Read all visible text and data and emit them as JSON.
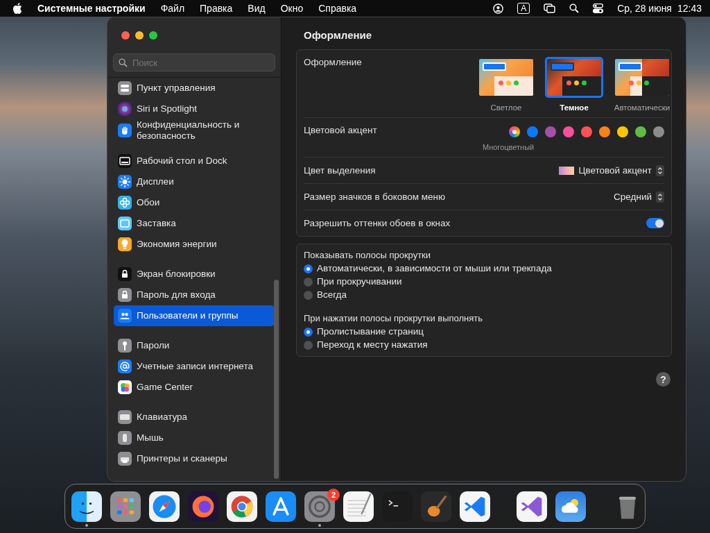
{
  "menubar": {
    "app_name": "Системные настройки",
    "menus": [
      "Файл",
      "Правка",
      "Вид",
      "Окно",
      "Справка"
    ],
    "input_source": "A",
    "date": "Ср, 28 июня",
    "time": "12:43"
  },
  "sidebar": {
    "search": {
      "placeholder": "Поиск"
    },
    "groups": [
      {
        "items": [
          {
            "label": "Пункт управления",
            "selected": false
          },
          {
            "label": "Siri и Spotlight",
            "selected": false
          },
          {
            "label": "Конфиденциальность и безопасность",
            "selected": false
          }
        ]
      },
      {
        "items": [
          {
            "label": "Рабочий стол и Dock",
            "selected": false
          },
          {
            "label": "Дисплеи",
            "selected": false
          },
          {
            "label": "Обои",
            "selected": false
          },
          {
            "label": "Заставка",
            "selected": false
          },
          {
            "label": "Экономия энергии",
            "selected": false
          }
        ]
      },
      {
        "items": [
          {
            "label": "Экран блокировки",
            "selected": false
          },
          {
            "label": "Пароль для входа",
            "selected": false
          },
          {
            "label": "Пользователи и группы",
            "selected": true
          }
        ]
      },
      {
        "items": [
          {
            "label": "Пароли",
            "selected": false
          },
          {
            "label": "Учетные записи интернета",
            "selected": false
          },
          {
            "label": "Game Center",
            "selected": false
          }
        ]
      },
      {
        "items": [
          {
            "label": "Клавиатура",
            "selected": false
          },
          {
            "label": "Мышь",
            "selected": false
          },
          {
            "label": "Принтеры и сканеры",
            "selected": false
          }
        ]
      }
    ]
  },
  "content": {
    "title": "Оформление",
    "appearance": {
      "label": "Оформление",
      "options": [
        {
          "kind": "light",
          "label": "Светлое",
          "selected": false
        },
        {
          "kind": "dark",
          "label": "Темное",
          "selected": true
        },
        {
          "kind": "auto",
          "label": "Автоматически",
          "selected": false
        }
      ]
    },
    "accent": {
      "label": "Цветовой акцент",
      "caption": "Многоцветный",
      "colors": [
        {
          "kind": "multicolor",
          "selected": true
        },
        {
          "kind": "solid",
          "color": "#0a7aff",
          "selected": false
        },
        {
          "kind": "solid",
          "color": "#a550a7",
          "selected": false
        },
        {
          "kind": "solid",
          "color": "#f74f9e",
          "selected": false
        },
        {
          "kind": "solid",
          "color": "#ff5257",
          "selected": false
        },
        {
          "kind": "solid",
          "color": "#f88317",
          "selected": false
        },
        {
          "kind": "solid",
          "color": "#ffc600",
          "selected": false
        },
        {
          "kind": "solid",
          "color": "#62ba46",
          "selected": false
        },
        {
          "kind": "solid",
          "color": "#8c8c8c",
          "selected": false
        }
      ]
    },
    "highlight": {
      "label": "Цвет выделения",
      "value": "Цветовой акцент"
    },
    "icon_size": {
      "label": "Размер значков в боковом меню",
      "value": "Средний"
    },
    "tinting": {
      "label": "Разрешить оттенки обоев в окнах",
      "on": true
    },
    "scroll_bars": {
      "title": "Показывать полосы прокрутки",
      "options": [
        {
          "label": "Автоматически, в зависимости от мыши или трекпада",
          "selected": true
        },
        {
          "label": "При прокручивании",
          "selected": false
        },
        {
          "label": "Всегда",
          "selected": false
        }
      ]
    },
    "scroll_click": {
      "title": "При нажатии полосы прокрутки выполнять",
      "options": [
        {
          "label": "Пролистывание страниц",
          "selected": true
        },
        {
          "label": "Переход к месту нажатия",
          "selected": false
        }
      ]
    },
    "help": "?"
  },
  "dock": {
    "groups": [
      {
        "apps": [
          {
            "running": true
          },
          {
            "running": false
          },
          {
            "running": false
          },
          {
            "running": false
          },
          {
            "running": false
          },
          {
            "running": false
          },
          {
            "running": true,
            "badge": "2"
          },
          {
            "running": false
          },
          {
            "running": false
          },
          {
            "running": false
          },
          {
            "running": false
          }
        ]
      },
      {
        "apps": [
          {
            "running": false
          },
          {
            "running": false
          }
        ]
      },
      {
        "apps": [
          {
            "running": false
          }
        ]
      }
    ]
  }
}
